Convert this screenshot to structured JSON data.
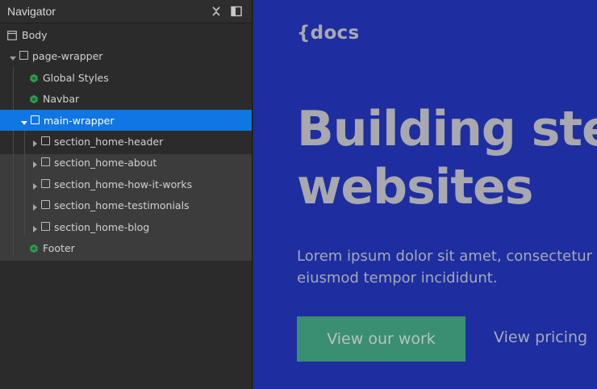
{
  "navigator": {
    "title": "Navigator",
    "tree": [
      {
        "label": "Body",
        "kind": "body"
      },
      {
        "label": "page-wrapper",
        "kind": "element",
        "expanded": true
      },
      {
        "label": "Global Styles",
        "kind": "symbol"
      },
      {
        "label": "Navbar",
        "kind": "symbol"
      },
      {
        "label": "main-wrapper",
        "kind": "element",
        "expanded": true,
        "selected": true
      },
      {
        "label": "section_home-header",
        "kind": "element",
        "expanded": false
      },
      {
        "label": "section_home-about",
        "kind": "element",
        "expanded": false
      },
      {
        "label": "section_home-how-it-works",
        "kind": "element",
        "expanded": false
      },
      {
        "label": "section_home-testimonials",
        "kind": "element",
        "expanded": false
      },
      {
        "label": "section_home-blog",
        "kind": "element",
        "expanded": false
      },
      {
        "label": "Footer",
        "kind": "symbol"
      }
    ]
  },
  "preview": {
    "logo": "{docs",
    "hero_line1": "Building stel",
    "hero_line2": "websites",
    "text_line1": "Lorem ipsum dolor sit amet, consectetur a",
    "text_line2": "eiusmod tempor incididunt.",
    "primary_button": "View our work",
    "secondary_link": "View pricing"
  },
  "colors": {
    "selection": "#1076e3",
    "symbol_green": "#2f9e4f",
    "canvas_bg": "#1e2ea0",
    "button_green": "#3a8e72"
  },
  "icons": {
    "collapse": "collapse-arrows-icon",
    "dock": "dock-panel-icon",
    "body": "body-window-icon",
    "element": "element-box-icon",
    "symbol": "symbol-component-icon",
    "caret": "caret-icon"
  }
}
